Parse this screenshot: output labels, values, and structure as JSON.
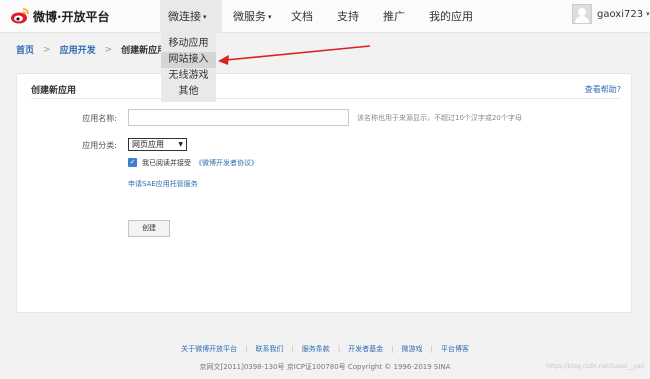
{
  "header": {
    "logo_text": "微博·开放平台",
    "nav": [
      {
        "label": "微连接",
        "has_caret": true
      },
      {
        "label": "微服务",
        "has_caret": true
      },
      {
        "label": "文档"
      },
      {
        "label": "支持"
      },
      {
        "label": "推广"
      },
      {
        "label": "我的应用"
      }
    ],
    "caret": "▾",
    "username": "gaoxi723",
    "user_caret": "▾"
  },
  "dropdown": {
    "items": [
      "移动应用",
      "网站接入",
      "无线游戏",
      "其他"
    ],
    "highlighted_index": 1
  },
  "breadcrumb": {
    "items": [
      "首页",
      "应用开发",
      "创建新应用"
    ],
    "separator": ">"
  },
  "form": {
    "title": "创建新应用",
    "help_link": "查看帮助?",
    "name_label": "应用名称:",
    "name_value": "",
    "name_hint": "该名称也用于来源显示，不超过10个汉字或20个字母",
    "category_label": "应用分类:",
    "category_value": "网页应用",
    "agree_checked": true,
    "agree_text": "我已阅读并接受",
    "agree_link": "《微博开发者协议》",
    "sae_link": "申请SAE应用托管服务",
    "create_button": "创建"
  },
  "footer": {
    "links": [
      "关于微博开放平台",
      "联系我们",
      "服务条款",
      "开发者基金",
      "微游戏",
      "平台博客"
    ],
    "copyright": "京网文[2011]0398-130号 京ICP证100780号 Copyright © 1996-2019 SINA",
    "watermark": "https://blog.csdn.net/Gaoxi__yall"
  },
  "colors": {
    "link": "#2e6db4",
    "annotation_arrow": "#e02020",
    "logo_red": "#e6162d"
  },
  "icons": {
    "logo": "weibo-eye-icon",
    "avatar": "user-avatar-icon",
    "checkbox": "checkmark-icon"
  }
}
